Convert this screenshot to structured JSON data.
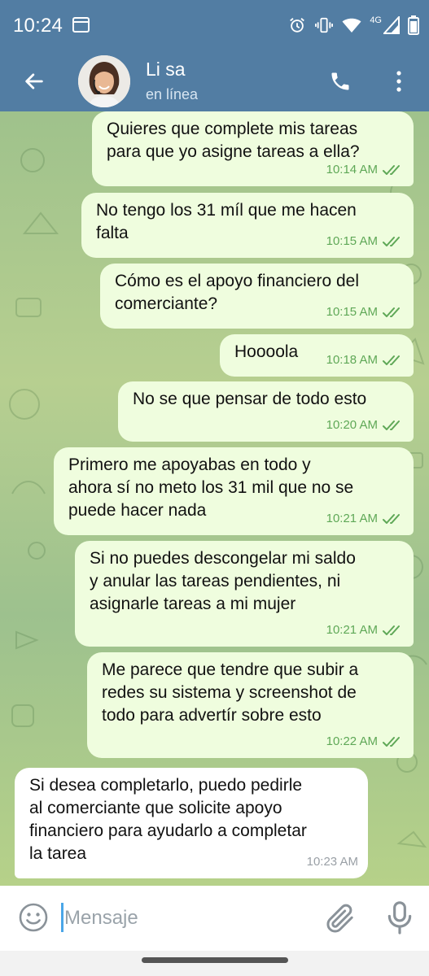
{
  "status_bar": {
    "time": "10:24",
    "network": "4G"
  },
  "header": {
    "contact_name": "Li sa",
    "contact_status": "en línea"
  },
  "messages": [
    {
      "direction": "out",
      "text": "Quieres que complete mis tareas\npara que yo asigne tareas a ella?",
      "time": "10:14 AM",
      "read": true
    },
    {
      "direction": "out",
      "text": "No tengo los 31 míl que me hacen\nfalta",
      "time": "10:15 AM",
      "read": true
    },
    {
      "direction": "out",
      "text": "Cómo es el apoyo financiero del\ncomerciante?",
      "time": "10:15 AM",
      "read": true
    },
    {
      "direction": "out",
      "text": "Hoooola",
      "time": "10:18 AM",
      "read": true
    },
    {
      "direction": "out",
      "text": "No se que pensar de todo esto",
      "time": "10:20 AM",
      "read": true
    },
    {
      "direction": "out",
      "text": "Primero me apoyabas en todo y\nahora sí no meto los 31 mil que no se\npuede hacer nada",
      "time": "10:21 AM",
      "read": true
    },
    {
      "direction": "out",
      "text": "Si no puedes descongelar mi saldo\ny anular las tareas pendientes, ni\nasignarle tareas a mi mujer",
      "time": "10:21 AM",
      "read": true
    },
    {
      "direction": "out",
      "text": "Me parece que tendre que subir a\nredes su sistema y screenshot de\ntodo para advertír sobre esto",
      "time": "10:22 AM",
      "read": true
    },
    {
      "direction": "in",
      "text": "Si desea completarlo, puedo pedirle\nal comerciante que solicite apoyo\nfinanciero para ayudarlo a completar\nla tarea",
      "time": "10:23 AM",
      "read": false
    }
  ],
  "input": {
    "placeholder": "Mensaje"
  },
  "colors": {
    "header": "#527da3",
    "outgoing_bubble": "#effdde",
    "incoming_bubble": "#ffffff",
    "read_check": "#5fa857"
  },
  "icons": {
    "back": "arrow-left-icon",
    "call": "phone-icon",
    "more": "more-vertical-icon",
    "emoji": "smiley-icon",
    "attach": "paperclip-icon",
    "mic": "microphone-icon"
  }
}
